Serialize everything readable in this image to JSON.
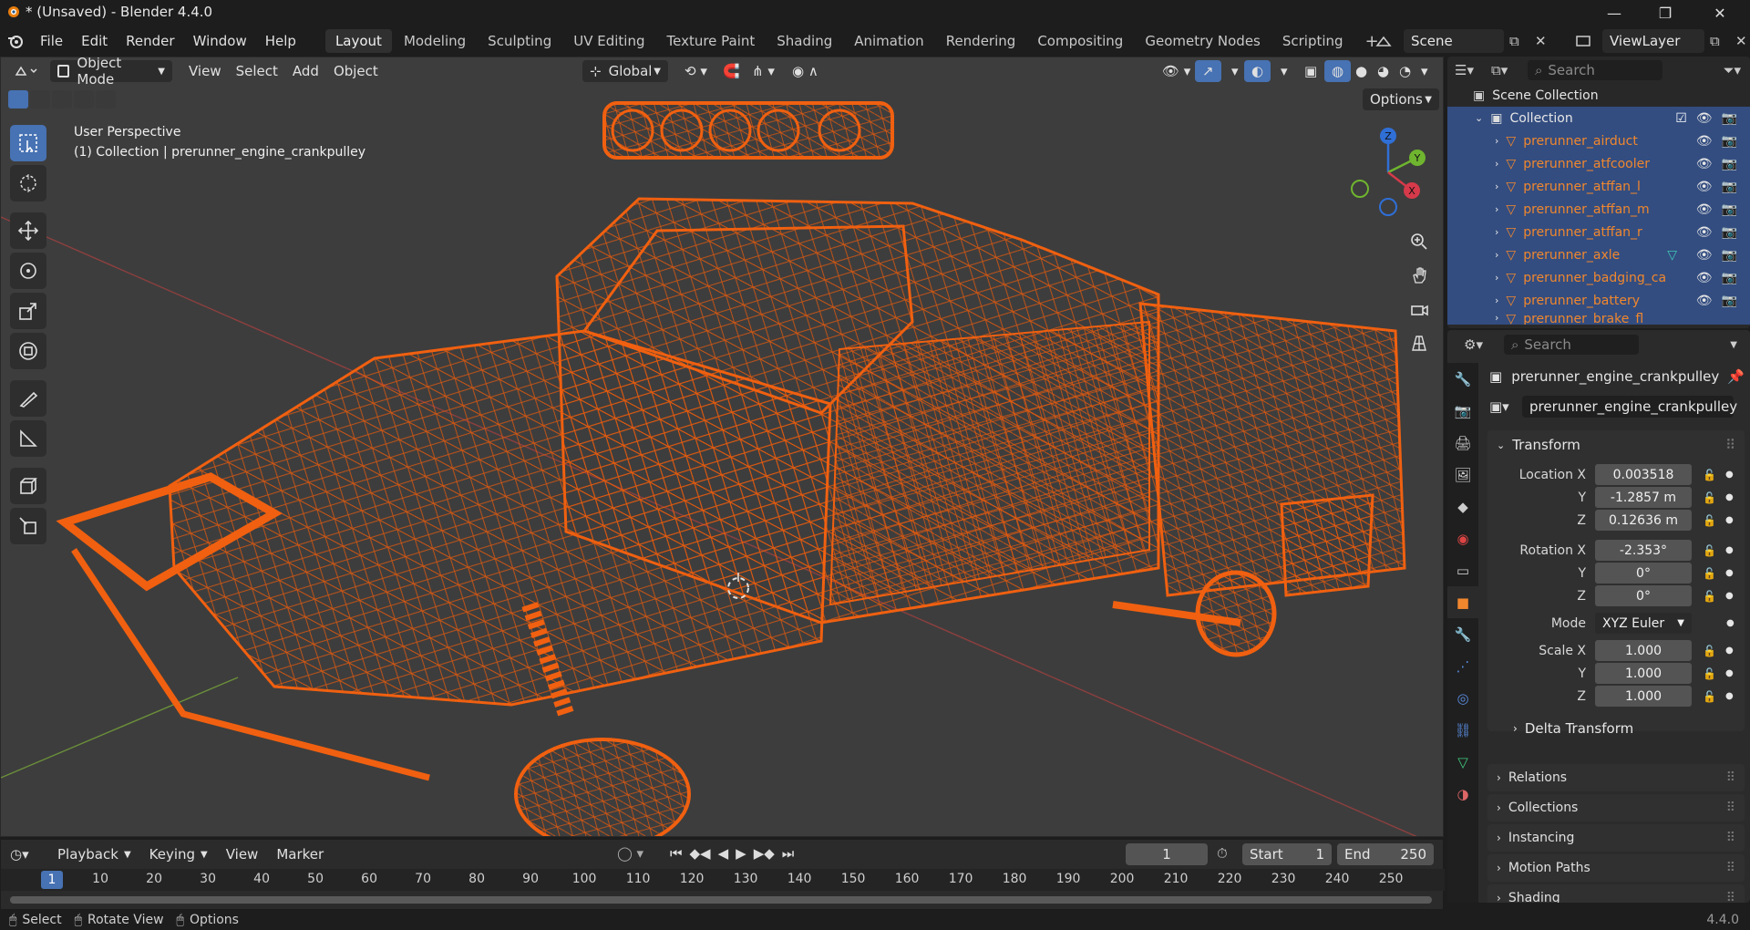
{
  "window": {
    "title": "* (Unsaved) - Blender 4.4.0",
    "minimize": "—",
    "maximize": "❐",
    "close": "✕"
  },
  "menu": [
    "File",
    "Edit",
    "Render",
    "Window",
    "Help"
  ],
  "workspaces": [
    "Layout",
    "Modeling",
    "Sculpting",
    "UV Editing",
    "Texture Paint",
    "Shading",
    "Animation",
    "Rendering",
    "Compositing",
    "Geometry Nodes",
    "Scripting"
  ],
  "scene": {
    "name": "Scene",
    "view_layer": "ViewLayer"
  },
  "viewport": {
    "mode": "Object Mode",
    "menus": [
      "View",
      "Select",
      "Add",
      "Object"
    ],
    "orientation": "Global",
    "options_label": "Options",
    "perspective_label": "User Perspective",
    "context_label": "(1) Collection | prerunner_engine_crankpulley",
    "gizmo_labels": {
      "x": "X",
      "y": "Y",
      "z": "Z"
    },
    "wire_color": "#e85a0c"
  },
  "outliner": {
    "search_placeholder": "Search",
    "scene_collection": "Scene Collection",
    "collection": "Collection",
    "objects": [
      "prerunner_airduct",
      "prerunner_atfcooler",
      "prerunner_atffan_l",
      "prerunner_atffan_m",
      "prerunner_atffan_r",
      "prerunner_axle",
      "prerunner_badging_ca",
      "prerunner_battery",
      "prerunner_brake_fl"
    ]
  },
  "properties": {
    "search_placeholder": "Search",
    "object_name": "prerunner_engine_crankpulley",
    "datablock_name": "prerunner_engine_crankpulley",
    "transform_title": "Transform",
    "location_label": "Location X",
    "location": {
      "x": "0.003518",
      "y": "-1.2857 m",
      "z": "0.12636 m"
    },
    "rotation_label": "Rotation X",
    "rotation": {
      "x": "-2.353°",
      "y": "0°",
      "z": "0°"
    },
    "mode_label": "Mode",
    "mode_value": "XYZ Euler",
    "scale_label": "Scale X",
    "scale": {
      "x": "1.000",
      "y": "1.000",
      "z": "1.000"
    },
    "axis_y": "Y",
    "axis_z": "Z",
    "delta_transform": "Delta Transform",
    "panels": [
      "Relations",
      "Collections",
      "Instancing",
      "Motion Paths",
      "Shading"
    ]
  },
  "timeline": {
    "menus": [
      "Playback",
      "Keying",
      "View",
      "Marker"
    ],
    "current_frame": "1",
    "start_label": "Start",
    "start": "1",
    "end_label": "End",
    "end": "250",
    "ruler_current": "1",
    "ruler": [
      "10",
      "20",
      "30",
      "40",
      "50",
      "60",
      "70",
      "80",
      "90",
      "100",
      "110",
      "120",
      "130",
      "140",
      "150",
      "160",
      "170",
      "180",
      "190",
      "200",
      "210",
      "220",
      "230",
      "240",
      "250"
    ]
  },
  "status": {
    "select": "Select",
    "rotate": "Rotate View",
    "options": "Options",
    "version": "4.4.0"
  }
}
